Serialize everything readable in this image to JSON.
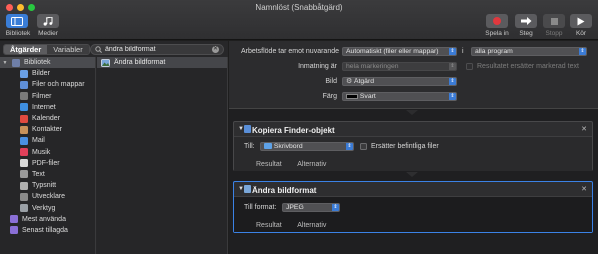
{
  "window": {
    "title": "Namnlöst (Snabbåtgärd)"
  },
  "toolbar": {
    "left": [
      {
        "label": "Bibliotek",
        "icon": "library-icon"
      },
      {
        "label": "Medier",
        "icon": "media-icon"
      }
    ],
    "right": [
      {
        "label": "Spela in",
        "icon": "record-icon"
      },
      {
        "label": "Steg",
        "icon": "step-icon"
      },
      {
        "label": "Stopp",
        "icon": "stop-icon"
      },
      {
        "label": "Kör",
        "icon": "run-icon"
      }
    ]
  },
  "tabs": {
    "actions": "Åtgärder",
    "variables": "Variabler"
  },
  "search": {
    "value": "ändra bildformat",
    "clear": "✕"
  },
  "library": {
    "root": "Bibliotek",
    "items": [
      {
        "label": "Bilder",
        "color": "#6aa0e6"
      },
      {
        "label": "Filer och mappar",
        "color": "#5f8fd8"
      },
      {
        "label": "Filmer",
        "color": "#7a7a7a"
      },
      {
        "label": "Internet",
        "color": "#3f8fe0"
      },
      {
        "label": "Kalender",
        "color": "#e04a3f"
      },
      {
        "label": "Kontakter",
        "color": "#c8925a"
      },
      {
        "label": "Mail",
        "color": "#4a90e2"
      },
      {
        "label": "Musik",
        "color": "#e0405a"
      },
      {
        "label": "PDF-filer",
        "color": "#d8d8d8"
      },
      {
        "label": "Text",
        "color": "#9a9a9a"
      },
      {
        "label": "Typsnitt",
        "color": "#b0b0b0"
      },
      {
        "label": "Utvecklare",
        "color": "#8a8a8a"
      },
      {
        "label": "Verktyg",
        "color": "#9aa0a6"
      }
    ],
    "groups": [
      {
        "label": "Mest använda",
        "color": "#8a6fd6"
      },
      {
        "label": "Senast tillagda",
        "color": "#8a6fd6"
      }
    ]
  },
  "results": [
    {
      "label": "Ändra bildformat"
    }
  ],
  "workflow_header": {
    "receives_label": "Arbetsflöde tar emot nuvarande",
    "receives_value": "Automatiskt (filer eller mappar)",
    "in_label": "i",
    "in_value": "alla program",
    "input_label": "Inmatning är",
    "input_value": "hela markeringen",
    "replace_label": "Resultatet ersätter markerad text",
    "image_label": "Bild",
    "image_value": "Åtgärd",
    "color_label": "Färg",
    "color_value": "Svart"
  },
  "actions": [
    {
      "title": "Kopiera Finder-objekt",
      "to_label": "Till:",
      "to_value": "Skrivbord",
      "replace_label": "Ersätter befintliga filer",
      "footer": [
        "Resultat",
        "Alternativ"
      ]
    },
    {
      "title": "Ändra bildformat",
      "to_label": "Till format:",
      "to_value": "JPEG",
      "footer": [
        "Resultat",
        "Alternativ"
      ]
    }
  ],
  "colors": {
    "accent": "#3b82e6",
    "record": "#e0383e"
  }
}
